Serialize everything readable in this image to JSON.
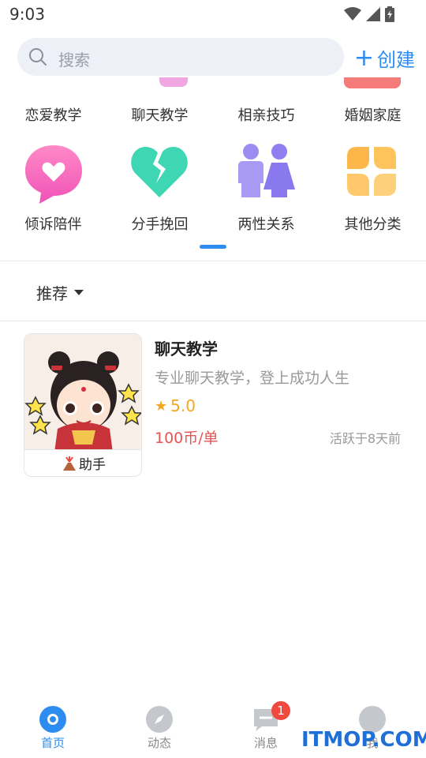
{
  "status": {
    "time": "9:03"
  },
  "search": {
    "placeholder": "搜索"
  },
  "create": {
    "label": "创建"
  },
  "categories_top": [
    {
      "label": "恋爱教学"
    },
    {
      "label": "聊天教学"
    },
    {
      "label": "相亲技巧"
    },
    {
      "label": "婚姻家庭"
    }
  ],
  "categories_bottom": [
    {
      "label": "倾诉陪伴",
      "icon": "chat-heart-icon"
    },
    {
      "label": "分手挽回",
      "icon": "broken-heart-icon"
    },
    {
      "label": "两性关系",
      "icon": "couple-icon"
    },
    {
      "label": "其他分类",
      "icon": "four-petal-icon"
    }
  ],
  "filter": {
    "label": "推荐"
  },
  "card": {
    "title": "聊天教学",
    "desc": "专业聊天教学，登上成功人生",
    "rating": "5.0",
    "price": "100币/单",
    "active": "活跃于8天前",
    "tag": "助手"
  },
  "tabs": [
    {
      "label": "首页",
      "active": true
    },
    {
      "label": "动态"
    },
    {
      "label": "消息",
      "badge": "1"
    },
    {
      "label": "我"
    }
  ],
  "watermark": "ITMOP.COM",
  "colors": {
    "accent": "#2d8cf0",
    "price": "#e85353",
    "star": "#f5a623"
  }
}
